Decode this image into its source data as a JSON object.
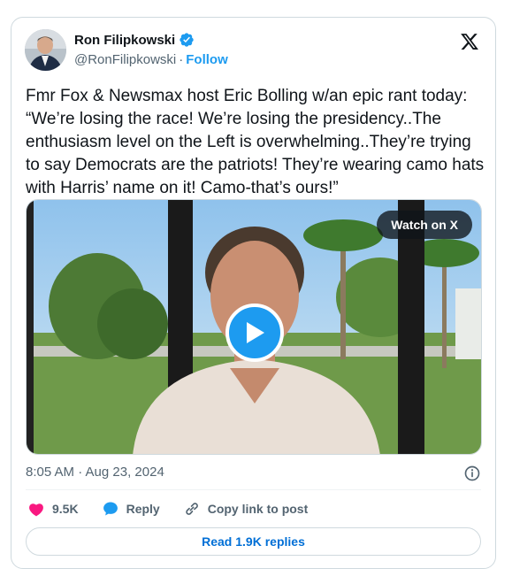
{
  "author": {
    "name": "Ron Filipkowski",
    "handle": "@RonFilipkowski",
    "separator": "·",
    "follow_label": "Follow"
  },
  "tweet": {
    "text": "Fmr Fox & Newsmax host Eric Bolling w/an epic rant today: “We’re losing the race! We’re losing the presidency..The enthusiasm level on the Left is overwhelming..They’re trying to say Democrats are the patriots! They’re wearing camo hats with Harris’ name on it! Camo-that’s ours!”",
    "timestamp": "8:05 AM · Aug 23, 2024"
  },
  "media": {
    "watch_label": "Watch on X"
  },
  "actions": {
    "likes": "9.5K",
    "reply_label": "Reply",
    "copy_label": "Copy link to post"
  },
  "replies_button": "Read 1.9K replies",
  "colors": {
    "accent": "#1d9bf0",
    "like": "#f91880",
    "text": "#0f1419",
    "muted": "#536471"
  }
}
